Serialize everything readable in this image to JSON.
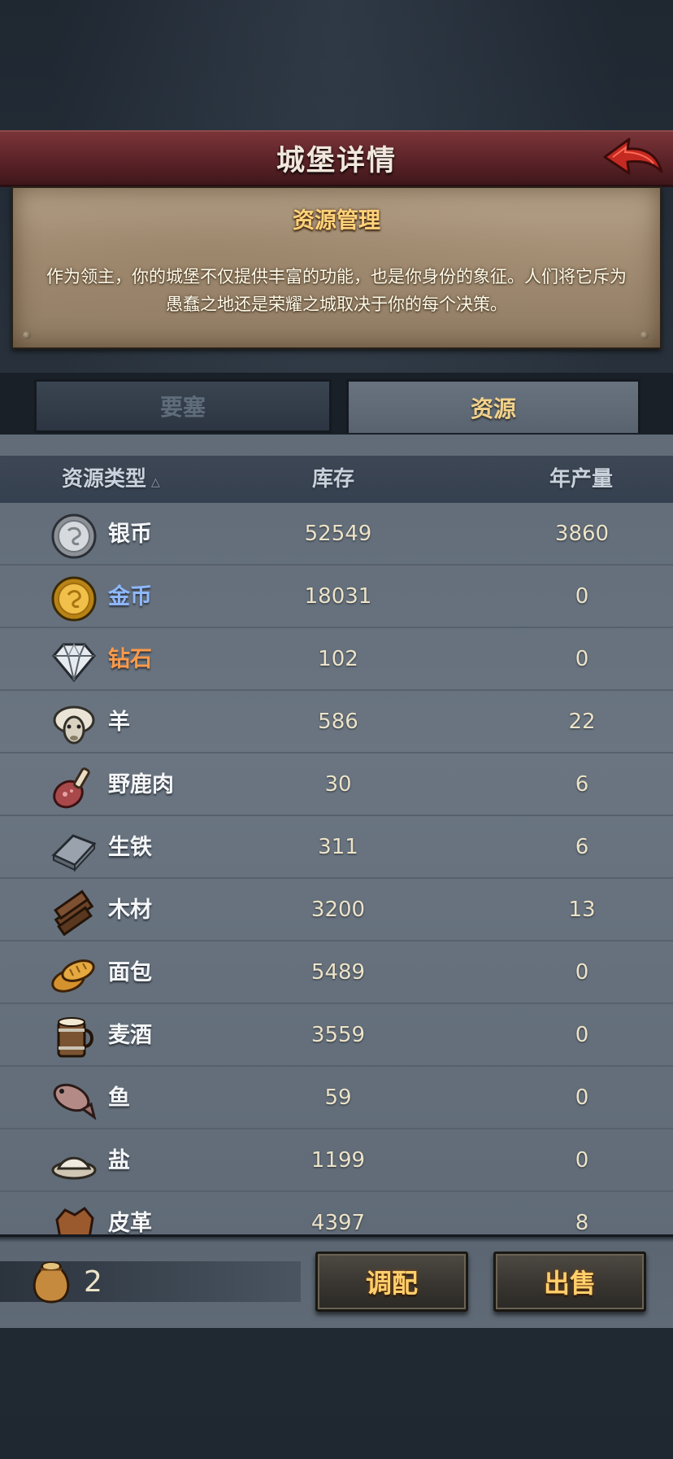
{
  "header": {
    "title": "城堡详情"
  },
  "panel": {
    "title": "资源管理",
    "description": "作为领主，你的城堡不仅提供丰富的功能，也是你身份的象征。人们将它斥为愚蠢之地还是荣耀之城取决于你的每个决策。"
  },
  "tabs": [
    {
      "label": "要塞",
      "active": false
    },
    {
      "label": "资源",
      "active": true
    }
  ],
  "table": {
    "columns": {
      "type": "资源类型",
      "sort_indicator": "△",
      "stock": "库存",
      "yield": "年产量"
    },
    "rows": [
      {
        "name": "银币",
        "stock": "52549",
        "yield": "3860",
        "name_color": "#f4f6f8",
        "icon": "silver-coin-icon"
      },
      {
        "name": "金币",
        "stock": "18031",
        "yield": "0",
        "name_color": "#8fb8ff",
        "icon": "gold-coin-icon"
      },
      {
        "name": "钻石",
        "stock": "102",
        "yield": "0",
        "name_color": "#ff9a4a",
        "icon": "diamond-icon"
      },
      {
        "name": "羊",
        "stock": "586",
        "yield": "22",
        "name_color": "#f4f6f8",
        "icon": "sheep-icon"
      },
      {
        "name": "野鹿肉",
        "stock": "30",
        "yield": "6",
        "name_color": "#f4f6f8",
        "icon": "venison-icon"
      },
      {
        "name": "生铁",
        "stock": "311",
        "yield": "6",
        "name_color": "#f4f6f8",
        "icon": "iron-ingot-icon"
      },
      {
        "name": "木材",
        "stock": "3200",
        "yield": "13",
        "name_color": "#f4f6f8",
        "icon": "wood-icon"
      },
      {
        "name": "面包",
        "stock": "5489",
        "yield": "0",
        "name_color": "#f4f6f8",
        "icon": "bread-icon"
      },
      {
        "name": "麦酒",
        "stock": "3559",
        "yield": "0",
        "name_color": "#f4f6f8",
        "icon": "ale-mug-icon"
      },
      {
        "name": "鱼",
        "stock": "59",
        "yield": "0",
        "name_color": "#f4f6f8",
        "icon": "fish-icon"
      },
      {
        "name": "盐",
        "stock": "1199",
        "yield": "0",
        "name_color": "#f4f6f8",
        "icon": "salt-icon"
      },
      {
        "name": "皮革",
        "stock": "4397",
        "yield": "8",
        "name_color": "#f4f6f8",
        "icon": "leather-icon"
      }
    ]
  },
  "footer": {
    "bag_count": "2",
    "allocate_label": "调配",
    "sell_label": "出售"
  }
}
